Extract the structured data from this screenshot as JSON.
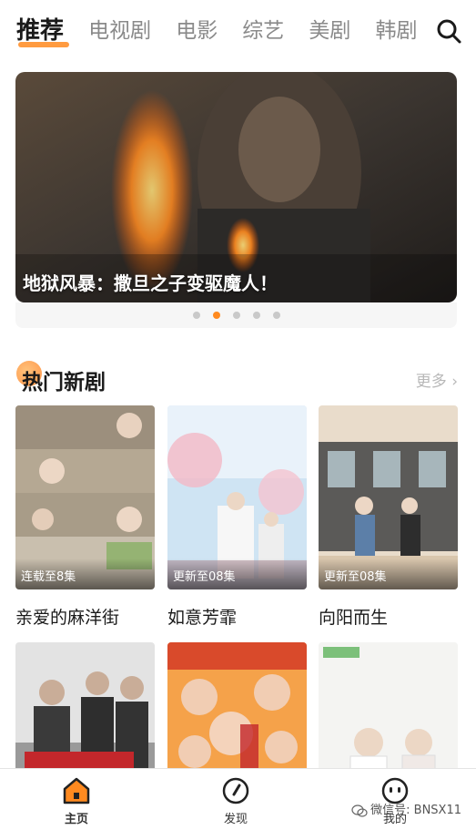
{
  "header": {
    "tabs": [
      {
        "label": "推荐",
        "active": true
      },
      {
        "label": "电视剧",
        "active": false
      },
      {
        "label": "电影",
        "active": false
      },
      {
        "label": "综艺",
        "active": false
      },
      {
        "label": "美剧",
        "active": false
      },
      {
        "label": "韩剧",
        "active": false
      }
    ],
    "search_icon": "search-icon"
  },
  "banner": {
    "caption": "地狱风暴：撒旦之子变驱魔人！",
    "dot_count": 5,
    "active_dot": 1
  },
  "hot_section": {
    "title": "热门新剧",
    "more_label": "更多",
    "items": [
      {
        "title": "亲爱的麻洋街",
        "badge": "连载至8集"
      },
      {
        "title": "如意芳霏",
        "badge": "更新至08集"
      },
      {
        "title": "向阳而生",
        "badge": "更新至08集"
      },
      {
        "title": "",
        "badge": ""
      },
      {
        "title": "",
        "badge": ""
      },
      {
        "title": "",
        "badge": ""
      }
    ]
  },
  "bottom_nav": {
    "items": [
      {
        "label": "主页",
        "icon": "home-icon",
        "active": true
      },
      {
        "label": "发现",
        "icon": "compass-icon",
        "active": false
      },
      {
        "label": "我的",
        "icon": "profile-face-icon",
        "active": false
      }
    ]
  },
  "watermark": "微信号: BNSX11",
  "colors": {
    "accent": "#ff8a1f",
    "text_primary": "#1a1a1a",
    "text_secondary": "#8a8a8a"
  }
}
